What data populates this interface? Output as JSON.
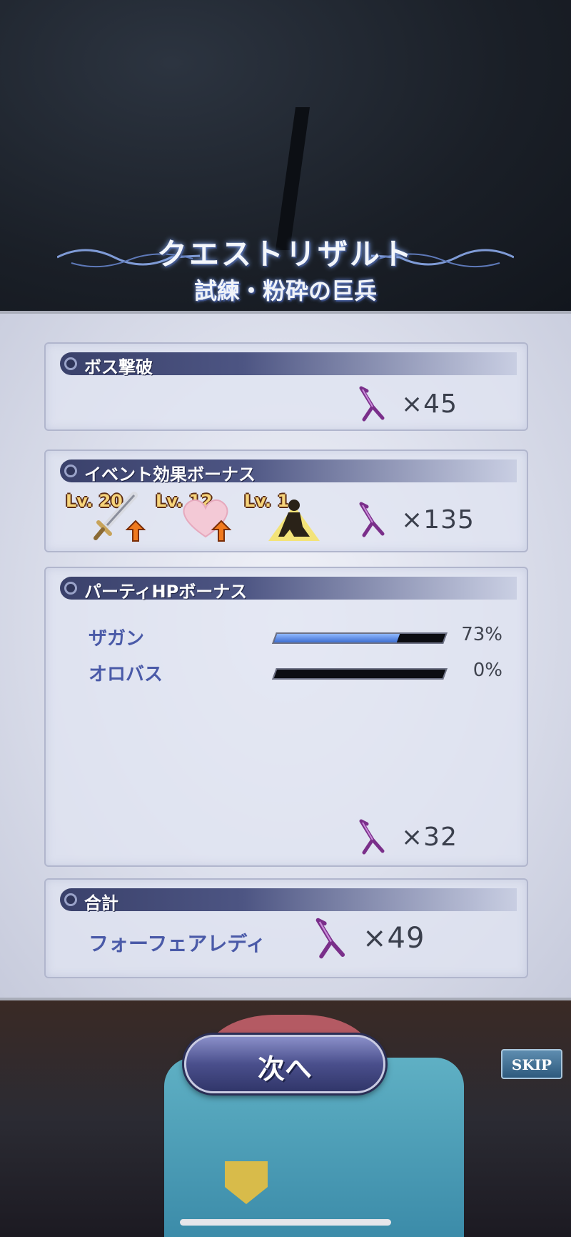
{
  "banner": {
    "title": "クエストリザルト",
    "subtitle": "試練・粉砕の巨兵"
  },
  "boss": {
    "header": "ボス撃破",
    "reward_qty": "×45"
  },
  "event_bonus": {
    "header": "イベント効果ボーナス",
    "levels": [
      {
        "label": "Lv. 20",
        "icon": "sword-icon"
      },
      {
        "label": "Lv. 12",
        "icon": "heart-icon"
      },
      {
        "label": "Lv. 1",
        "icon": "kneeling-figure-icon"
      }
    ],
    "reward_qty": "×135"
  },
  "party_hp": {
    "header": "パーティHPボーナス",
    "members": [
      {
        "name": "ザガン",
        "hp_percent_text": "73%",
        "hp_fraction": 0.73
      },
      {
        "name": "オロバス",
        "hp_percent_text": "0%",
        "hp_fraction": 0
      }
    ],
    "reward_qty": "×32"
  },
  "total": {
    "header": "合計",
    "item_name": "フォーフェアレディ",
    "reward_qty": "×49"
  },
  "buttons": {
    "next": "次へ",
    "skip": "SKIP"
  },
  "colors": {
    "accent_text": "#4a5aa8",
    "header_bar": "#3a416b",
    "hp_fill": "#3e6fd0"
  }
}
